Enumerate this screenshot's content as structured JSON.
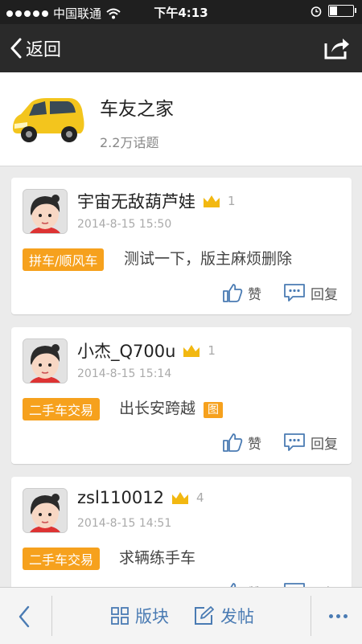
{
  "status_bar": {
    "carrier": "中国联通",
    "time": "下午4:13"
  },
  "nav": {
    "back_label": "返回"
  },
  "forum": {
    "title": "车友之家",
    "topic_count": "2.2万话题"
  },
  "posts": [
    {
      "username": "宇宙无敌葫芦娃",
      "level": "1",
      "time": "2014-8-15 15:50",
      "tag": "拼车/顺风车",
      "text": "测试一下，版主麻烦删除",
      "has_image": false,
      "like_label": "赞",
      "reply_label": "回复"
    },
    {
      "username": "小杰_Q700u",
      "level": "1",
      "time": "2014-8-15 15:14",
      "tag": "二手车交易",
      "text": "出长安跨越",
      "has_image": true,
      "image_badge": "图",
      "like_label": "赞",
      "reply_label": "回复"
    },
    {
      "username": "zsl110012",
      "level": "4",
      "time": "2014-8-15 14:51",
      "tag": "二手车交易",
      "text": "求辆练手车",
      "has_image": false,
      "like_label": "赞",
      "reply_label": "回复"
    }
  ],
  "tabbar": {
    "sections_label": "版块",
    "post_label": "发帖"
  },
  "colors": {
    "accent_tag": "#f6a11d",
    "tab_blue": "#4a7bb3",
    "crown": "#f2b811",
    "nav_bg": "#2a2a2a"
  },
  "icons": [
    "wifi-icon",
    "alarm-icon",
    "battery-icon",
    "back-chevron-icon",
    "share-icon",
    "crown-icon",
    "like-icon",
    "reply-icon",
    "grid-icon",
    "edit-icon",
    "more-icon"
  ]
}
